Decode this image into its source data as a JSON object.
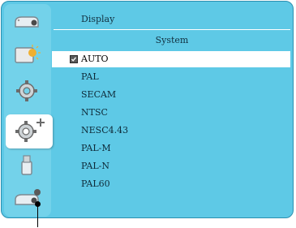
{
  "breadcrumb": "Display",
  "section_title": "System",
  "selected_value": "AUTO",
  "options": [
    {
      "label": "AUTO",
      "selected": true
    },
    {
      "label": "PAL",
      "selected": false
    },
    {
      "label": "SECAM",
      "selected": false
    },
    {
      "label": "NTSC",
      "selected": false
    },
    {
      "label": "NESC4.43",
      "selected": false
    },
    {
      "label": "PAL-M",
      "selected": false
    },
    {
      "label": "PAL-N",
      "selected": false
    },
    {
      "label": "PAL60",
      "selected": false
    }
  ],
  "sidebar": {
    "items": [
      {
        "icon": "projector-icon",
        "active": false
      },
      {
        "icon": "picture-adjust-icon",
        "active": false
      },
      {
        "icon": "gear-icon",
        "active": false
      },
      {
        "icon": "gear-plus-icon",
        "active": true
      },
      {
        "icon": "usb-icon",
        "active": false
      },
      {
        "icon": "projector-info-icon",
        "active": false
      }
    ]
  },
  "colors": {
    "panel": "#5ec9e6",
    "sidebar": "#73d2ea",
    "selected_row": "#ffffff",
    "text": "#0e2a38"
  }
}
